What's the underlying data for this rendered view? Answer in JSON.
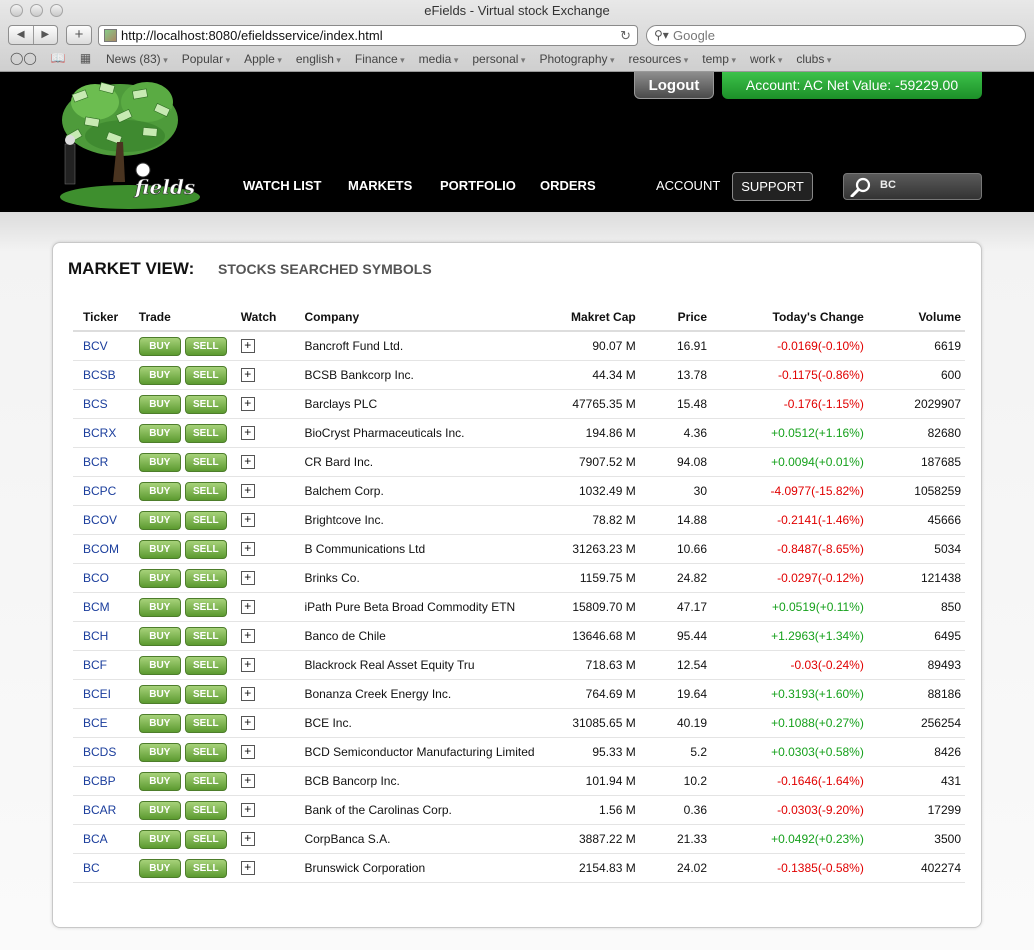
{
  "browser": {
    "window_title": "eFields - Virtual stock Exchange",
    "url": "http://localhost:8080/efieldsservice/index.html",
    "search_placeholder": "Google",
    "bookmarks": [
      "News (83)",
      "Popular",
      "Apple",
      "english",
      "Finance",
      "media",
      "personal",
      "Photography",
      "resources",
      "temp",
      "work",
      "clubs"
    ]
  },
  "header": {
    "logout_label": "Logout",
    "account_label": "Account: AC Net Value: -59229.00",
    "nav": [
      "WATCH LIST",
      "MARKETS",
      "PORTFOLIO",
      "ORDERS",
      "ACCOUNT",
      "SUPPORT"
    ],
    "search_value": "BC",
    "colors": {
      "account_green": "#22a02e",
      "header_bg": "#000000"
    }
  },
  "panel": {
    "title": "MARKET VIEW:",
    "subtitle": "STOCKS SEARCHED SYMBOLS",
    "columns": [
      "Ticker",
      "Trade",
      "Watch",
      "Company",
      "Makret Cap",
      "Price",
      "Today's Change",
      "Volume"
    ],
    "buy_label": "BUY",
    "sell_label": "SELL",
    "watch_glyph": "+",
    "rows": [
      {
        "ticker": "BCV",
        "company": "Bancroft Fund Ltd.",
        "cap": "90.07 M",
        "price": "16.91",
        "change": "-0.0169(-0.10%)",
        "dir": "neg",
        "volume": "6619"
      },
      {
        "ticker": "BCSB",
        "company": "BCSB Bankcorp Inc.",
        "cap": "44.34 M",
        "price": "13.78",
        "change": "-0.1175(-0.86%)",
        "dir": "neg",
        "volume": "600"
      },
      {
        "ticker": "BCS",
        "company": "Barclays PLC",
        "cap": "47765.35 M",
        "price": "15.48",
        "change": "-0.176(-1.15%)",
        "dir": "neg",
        "volume": "2029907"
      },
      {
        "ticker": "BCRX",
        "company": "BioCryst Pharmaceuticals Inc.",
        "cap": "194.86 M",
        "price": "4.36",
        "change": "+0.0512(+1.16%)",
        "dir": "pos",
        "volume": "82680"
      },
      {
        "ticker": "BCR",
        "company": "CR Bard Inc.",
        "cap": "7907.52 M",
        "price": "94.08",
        "change": "+0.0094(+0.01%)",
        "dir": "pos",
        "volume": "187685"
      },
      {
        "ticker": "BCPC",
        "company": "Balchem Corp.",
        "cap": "1032.49 M",
        "price": "30",
        "change": "-4.0977(-15.82%)",
        "dir": "neg",
        "volume": "1058259"
      },
      {
        "ticker": "BCOV",
        "company": "Brightcove Inc.",
        "cap": "78.82 M",
        "price": "14.88",
        "change": "-0.2141(-1.46%)",
        "dir": "neg",
        "volume": "45666"
      },
      {
        "ticker": "BCOM",
        "company": "B Communications Ltd",
        "cap": "31263.23 M",
        "price": "10.66",
        "change": "-0.8487(-8.65%)",
        "dir": "neg",
        "volume": "5034"
      },
      {
        "ticker": "BCO",
        "company": "Brinks Co.",
        "cap": "1159.75 M",
        "price": "24.82",
        "change": "-0.0297(-0.12%)",
        "dir": "neg",
        "volume": "121438"
      },
      {
        "ticker": "BCM",
        "company": "iPath Pure Beta Broad Commodity ETN",
        "cap": "15809.70 M",
        "price": "47.17",
        "change": "+0.0519(+0.11%)",
        "dir": "pos",
        "volume": "850"
      },
      {
        "ticker": "BCH",
        "company": "Banco de Chile",
        "cap": "13646.68 M",
        "price": "95.44",
        "change": "+1.2963(+1.34%)",
        "dir": "pos",
        "volume": "6495"
      },
      {
        "ticker": "BCF",
        "company": "Blackrock Real Asset Equity Tru",
        "cap": "718.63 M",
        "price": "12.54",
        "change": "-0.03(-0.24%)",
        "dir": "neg",
        "volume": "89493"
      },
      {
        "ticker": "BCEI",
        "company": "Bonanza Creek Energy Inc.",
        "cap": "764.69 M",
        "price": "19.64",
        "change": "+0.3193(+1.60%)",
        "dir": "pos",
        "volume": "88186"
      },
      {
        "ticker": "BCE",
        "company": "BCE Inc.",
        "cap": "31085.65 M",
        "price": "40.19",
        "change": "+0.1088(+0.27%)",
        "dir": "pos",
        "volume": "256254"
      },
      {
        "ticker": "BCDS",
        "company": "BCD Semiconductor Manufacturing Limited",
        "cap": "95.33 M",
        "price": "5.2",
        "change": "+0.0303(+0.58%)",
        "dir": "pos",
        "volume": "8426"
      },
      {
        "ticker": "BCBP",
        "company": "BCB Bancorp Inc.",
        "cap": "101.94 M",
        "price": "10.2",
        "change": "-0.1646(-1.64%)",
        "dir": "neg",
        "volume": "431"
      },
      {
        "ticker": "BCAR",
        "company": "Bank of the Carolinas Corp.",
        "cap": "1.56 M",
        "price": "0.36",
        "change": "-0.0303(-9.20%)",
        "dir": "neg",
        "volume": "17299"
      },
      {
        "ticker": "BCA",
        "company": "CorpBanca S.A.",
        "cap": "3887.22 M",
        "price": "21.33",
        "change": "+0.0492(+0.23%)",
        "dir": "pos",
        "volume": "3500"
      },
      {
        "ticker": "BC",
        "company": "Brunswick Corporation",
        "cap": "2154.83 M",
        "price": "24.02",
        "change": "-0.1385(-0.58%)",
        "dir": "neg",
        "volume": "402274"
      }
    ]
  }
}
